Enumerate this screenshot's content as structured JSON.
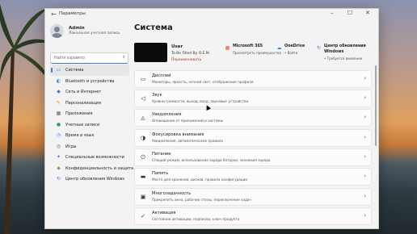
{
  "window": {
    "title": "Параметры",
    "back_icon": "back-arrow-icon",
    "minimize": "–",
    "maximize": "☐",
    "close": "✕"
  },
  "profile": {
    "name": "Admin",
    "subtitle": "Локальная учетная запись"
  },
  "search": {
    "placeholder": "Найти параметр",
    "icon": "search-icon"
  },
  "sidebar": {
    "items": [
      {
        "label": "Система",
        "icon": "▭",
        "color": "#2f7fd6",
        "active": true
      },
      {
        "label": "Bluetooth и устройства",
        "icon": "◐",
        "color": "#2f7fd6",
        "active": false
      },
      {
        "label": "Сеть и Интернет",
        "icon": "◆",
        "color": "#2f7fd6",
        "active": false
      },
      {
        "label": "Персонализация",
        "icon": "✎",
        "color": "#e08a2a",
        "active": false
      },
      {
        "label": "Приложения",
        "icon": "▦",
        "color": "#5a6a7a",
        "active": false
      },
      {
        "label": "Учетные записи",
        "icon": "●",
        "color": "#2fa060",
        "active": false
      },
      {
        "label": "Время и язык",
        "icon": "◷",
        "color": "#2f7fd6",
        "active": false
      },
      {
        "label": "Игры",
        "icon": "◎",
        "color": "#6a6a6a",
        "active": false
      },
      {
        "label": "Специальные возможности",
        "icon": "✦",
        "color": "#2f7fd6",
        "active": false
      },
      {
        "label": "Конфиденциальность и защита",
        "icon": "◈",
        "color": "#6a6a6a",
        "active": false
      },
      {
        "label": "Центр обновления Windows",
        "icon": "↻",
        "color": "#2f7fd6",
        "active": false
      }
    ]
  },
  "main": {
    "title": "Система",
    "device": {
      "name": "User",
      "model": "To Be Filled By O.E.M.",
      "rename": "Переименовать"
    },
    "quick_links": [
      {
        "title": "Microsoft 365",
        "subtitle": "Просмотреть преимущества",
        "icon": "▦",
        "color": "#e8542f"
      },
      {
        "title": "OneDrive",
        "subtitle": "• Войти",
        "icon": "☁",
        "color": "#2f7fd6"
      },
      {
        "title": "Центр обновления",
        "title2": "Windows",
        "subtitle": "• Требуется внимание",
        "icon": "↻",
        "color": "#2f7fd6"
      }
    ],
    "cards": [
      {
        "title": "Дисплей",
        "subtitle": "Мониторы, яркость, ночной свет, отображение профиля",
        "icon": "▭"
      },
      {
        "title": "Звук",
        "subtitle": "Уровни громкости, выход, вход, звуковые устройства",
        "icon": "◁"
      },
      {
        "title": "Уведомления",
        "subtitle": "Оповещения от приложений и системы",
        "icon": "◬"
      },
      {
        "title": "Фокусировка внимания",
        "subtitle": "Уведомления, автоматические правила",
        "icon": "◑"
      },
      {
        "title": "Питание",
        "subtitle": "Спящий режим, использование заряда батареи, экономия заряда",
        "icon": "⏻"
      },
      {
        "title": "Память",
        "subtitle": "Место для хранения, дисков, правила конфигурации",
        "icon": "▬"
      },
      {
        "title": "Многозадачность",
        "subtitle": "Прикрепить окна, рабочие столы, переключение задач",
        "icon": "▣"
      },
      {
        "title": "Активация",
        "subtitle": "Состояние активации, подписки, ключ продукта",
        "icon": "✓"
      }
    ]
  }
}
